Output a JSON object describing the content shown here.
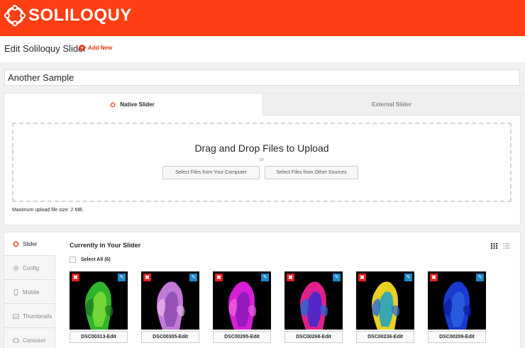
{
  "brand": {
    "name": "SOLILOQUY",
    "color": "#ff3e13"
  },
  "header": {
    "title": "Edit Soliloquy Slider",
    "add_new": "Add New"
  },
  "slider_title": {
    "value": "Another Sample"
  },
  "tabs": [
    {
      "label": "Native Slider",
      "active": true
    },
    {
      "label": "External Slider",
      "active": false
    }
  ],
  "upload": {
    "heading": "Drag and Drop Files to Upload",
    "or": "or",
    "btn_computer": "Select Files from Your Computer",
    "btn_other": "Select Files from Other Sources",
    "max_size": "Maximum upload file size: 2 MB."
  },
  "sidebar": {
    "items": [
      {
        "label": "Slider",
        "icon": "slider-icon",
        "active": true
      },
      {
        "label": "Config",
        "icon": "gear-icon",
        "active": false
      },
      {
        "label": "Mobile",
        "icon": "mobile-icon",
        "active": false
      },
      {
        "label": "Thumbnails",
        "icon": "image-icon",
        "active": false
      },
      {
        "label": "Carousel",
        "icon": "carousel-icon",
        "active": false
      }
    ]
  },
  "slides": {
    "title": "Currently in Your Slider",
    "select_all": "Select All (6)",
    "items": [
      {
        "caption": "DSC00313-Edit",
        "colors": [
          "#2fb52a",
          "#7fdc3a",
          "#1e7a1e"
        ]
      },
      {
        "caption": "DSC00305-Edit",
        "colors": [
          "#c27ad8",
          "#8e4bb0",
          "#e6b0ee"
        ]
      },
      {
        "caption": "DSC00295-Edit",
        "colors": [
          "#d81fd8",
          "#8a1ab8",
          "#f060e0"
        ]
      },
      {
        "caption": "DSC00268-Edit",
        "colors": [
          "#e0208a",
          "#3a2ad0",
          "#1e6ad8"
        ]
      },
      {
        "caption": "DSC00236-Edit",
        "colors": [
          "#e8d020",
          "#1aa0c8",
          "#2a6ad8"
        ]
      },
      {
        "caption": "DSC00209-Edit",
        "colors": [
          "#1a3ad0",
          "#2e62e0",
          "#0e1ea0"
        ]
      }
    ]
  }
}
